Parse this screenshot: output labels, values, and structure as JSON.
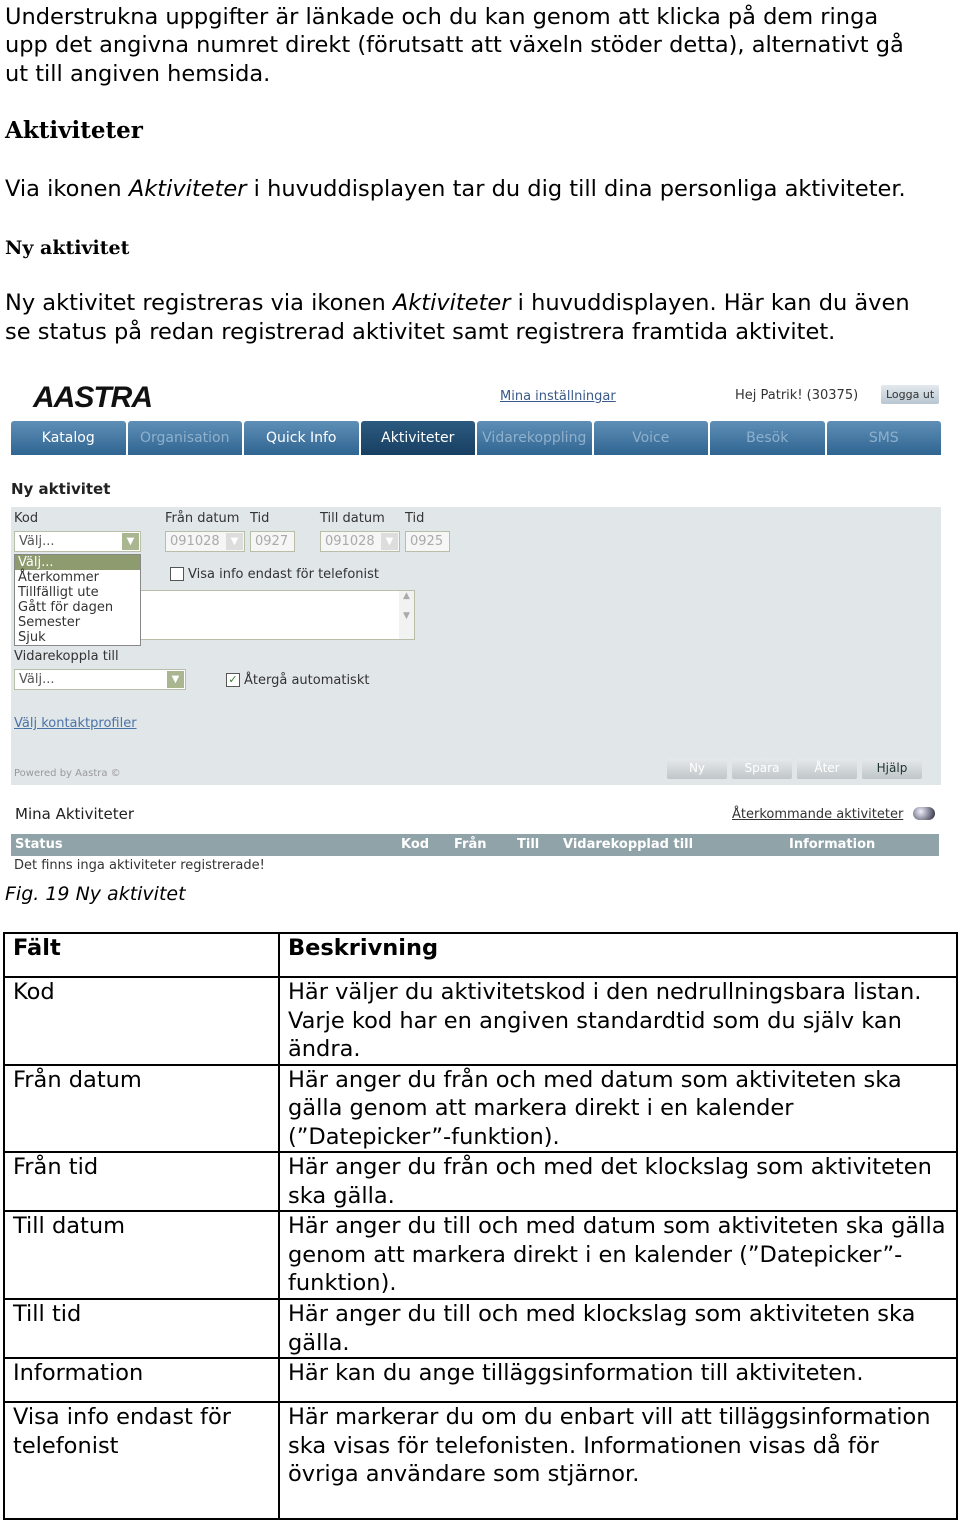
{
  "intro_lines": [
    "Understrukna uppgifter är länkade och du kan genom att klicka på dem ringa",
    "upp det angivna numret direkt (förutsatt att växeln stöder detta), alternativt gå",
    "ut till angiven hemsida."
  ],
  "heading1": "Aktiviteter",
  "para1": {
    "pre": "Via ikonen ",
    "em": "Aktiviteter",
    "post": " i huvuddisplayen tar du dig till dina personliga aktiviteter."
  },
  "heading2": "Ny aktivitet",
  "para2": {
    "pre": "Ny aktivitet registreras via ikonen ",
    "em": "Aktiviteter",
    "post": " i huvuddisplayen. Här kan du även",
    "line2": "se status på redan registrerad aktivitet samt registrera framtida aktivitet."
  },
  "screenshot": {
    "logo": "AASTRA",
    "settings_link": "Mina inställningar",
    "greeting": "Hej Patrik! (30375)",
    "logout": "Logga ut",
    "tabs": [
      "Katalog",
      "Organisation",
      "Quick Info",
      "Aktiviteter",
      "Vidarekoppling",
      "Voice",
      "Besök",
      "SMS"
    ],
    "active_tab": "Aktiviteter",
    "form_title": "Ny aktivitet",
    "labels": {
      "kod": "Kod",
      "fran_datum": "Från datum",
      "tid1": "Tid",
      "till_datum": "Till datum",
      "tid2": "Tid",
      "vidarekoppla": "Vidarekoppla till"
    },
    "kod_value": "Välj...",
    "fran_datum": "091028",
    "fran_tid": "0927",
    "till_datum": "091028",
    "till_tid": "0925",
    "kod_options": [
      "Välj...",
      "Återkommer",
      "Tillfälligt ute",
      "Gått för dagen",
      "Semester",
      "Sjuk"
    ],
    "visa_info": "Visa info endast för telefonist",
    "vidarekoppla_value": "Välj...",
    "atergaa": "Återgå automatiskt",
    "kontaktprofiler": "Välj kontaktprofiler",
    "powered": "Powered by Aastra ©",
    "buttons": [
      "Ny",
      "Spara",
      "Åter",
      "Hjälp"
    ],
    "mina_title": "Mina Aktiviteter",
    "recurring_link": "Återkommande aktiviteter",
    "columns": [
      "Status",
      "Kod",
      "Från",
      "Till",
      "Vidarekopplad till",
      "Information"
    ],
    "empty": "Det finns inga aktiviteter registrerade!"
  },
  "caption": "Fig. 19 Ny aktivitet",
  "table": {
    "headers": [
      "Fält",
      "Beskrivning"
    ],
    "rows": [
      [
        "Kod",
        "Här väljer du aktivitetskod i den nedrullningsbara listan. Varje kod har en angiven standardtid som du själv kan ändra."
      ],
      [
        "Från datum",
        "Här anger du från och med datum som aktiviteten ska gälla genom att markera direkt i en kalender (”Datepicker”-funktion)."
      ],
      [
        "Från tid",
        "Här anger du från och med det klockslag som aktiviteten ska gälla."
      ],
      [
        "Till datum",
        "Här anger du till och med datum som aktiviteten ska gälla genom att markera direkt i en kalender (”Datepicker”-funktion)."
      ],
      [
        "Till tid",
        "Här anger du till och med klockslag som aktiviteten ska gälla."
      ],
      [
        "Information",
        "Här kan du ange tilläggsinformation till aktiviteten."
      ],
      [
        "Visa info endast för telefonist",
        "Här markerar du om du enbart vill att tilläggsinformation ska visas för telefonisten. Informationen visas då för övriga användare som stjärnor."
      ]
    ]
  }
}
